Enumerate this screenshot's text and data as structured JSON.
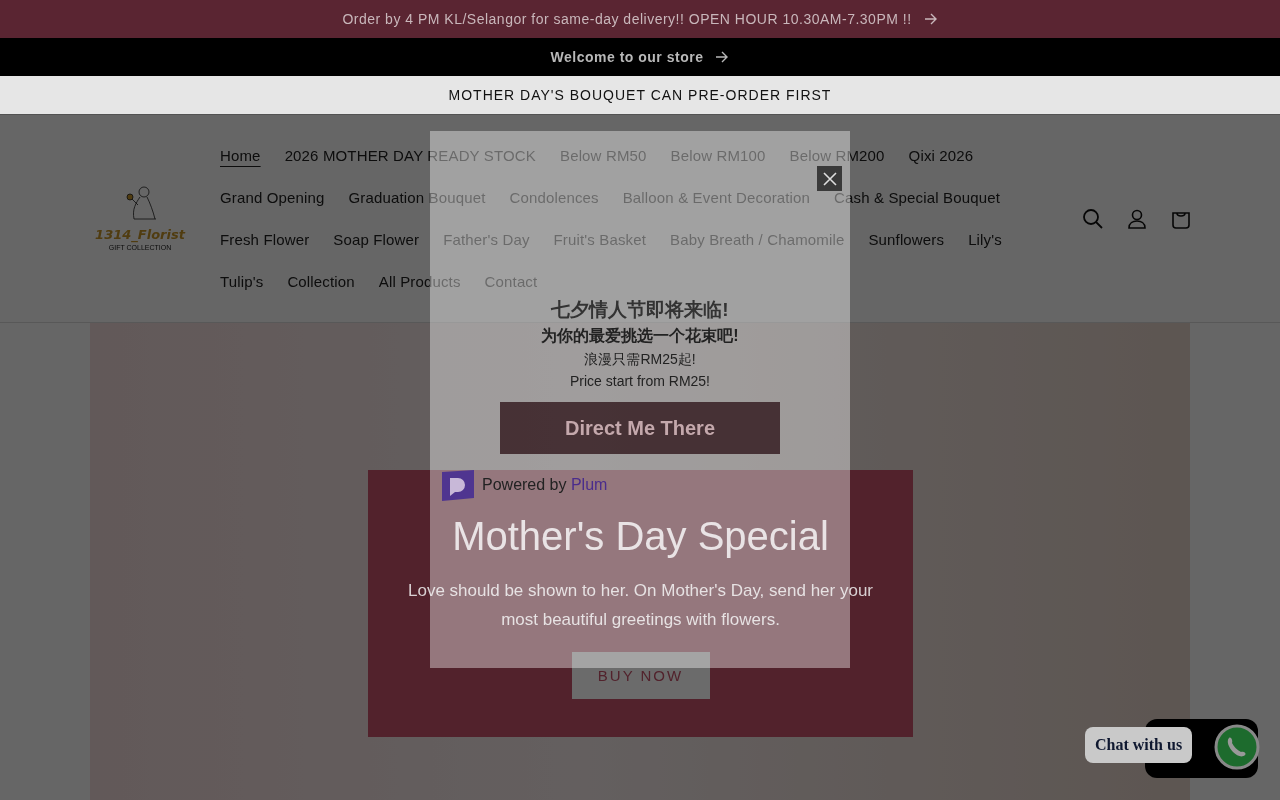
{
  "announcements": [
    {
      "text": "Order by 4 PM KL/Selangor for same-day delivery!! OPEN HOUR 10.30AM-7.30PM !!",
      "kind": "promo",
      "arrow": true
    },
    {
      "text": "Welcome to our store",
      "kind": "dark",
      "arrow": true
    },
    {
      "text": "MOTHER DAY'S BOUQUET CAN PRE-ORDER FIRST",
      "kind": "light",
      "arrow": false
    }
  ],
  "logo": {
    "name": "1314_Florist",
    "tagline": "GIFT COLLECTION"
  },
  "nav": [
    {
      "label": "Home",
      "selected": true
    },
    {
      "label": "2026 MOTHER DAY READY STOCK",
      "selected": false
    },
    {
      "label": "Below RM50",
      "selected": false
    },
    {
      "label": "Below RM100",
      "selected": false
    },
    {
      "label": "Below RM200",
      "selected": false
    },
    {
      "label": "Qixi 2026",
      "selected": false
    },
    {
      "label": "Grand Opening",
      "selected": false
    },
    {
      "label": "Graduation Bouquet",
      "selected": false
    },
    {
      "label": "Condolences",
      "selected": false
    },
    {
      "label": "Balloon & Event Decoration",
      "selected": false
    },
    {
      "label": "Cash & Special Bouquet",
      "selected": false
    },
    {
      "label": "Fresh Flower",
      "selected": false
    },
    {
      "label": "Soap Flower",
      "selected": false
    },
    {
      "label": "Father's Day",
      "selected": false
    },
    {
      "label": "Fruit's Basket",
      "selected": false
    },
    {
      "label": "Baby Breath / Chamomile",
      "selected": false
    },
    {
      "label": "Sunflowers",
      "selected": false
    },
    {
      "label": "Lily's",
      "selected": false
    },
    {
      "label": "Tulip's",
      "selected": false
    },
    {
      "label": "Collection",
      "selected": false
    },
    {
      "label": "All Products",
      "selected": false
    },
    {
      "label": "Contact",
      "selected": false
    }
  ],
  "promo_popup": {
    "title": "Mother's Day Special",
    "text": "Love should be shown to her. On Mother's Day, send her your most beautiful greetings with flowers.",
    "button": "BUY NOW"
  },
  "plum_popup": {
    "lines": [
      {
        "text": "七夕情人节即将来临!",
        "kind": "heading"
      },
      {
        "text": "为你的最爱挑选一个花束吧!",
        "kind": "subheading"
      },
      {
        "text": "浪漫只需RM25起!",
        "kind": "body"
      },
      {
        "text": "Price start from RM25!",
        "kind": "body"
      }
    ],
    "button": "Direct Me There",
    "powered_by": "Powered by",
    "brand": "Plum"
  },
  "chat_widget": {
    "label": "Chat with us"
  }
}
